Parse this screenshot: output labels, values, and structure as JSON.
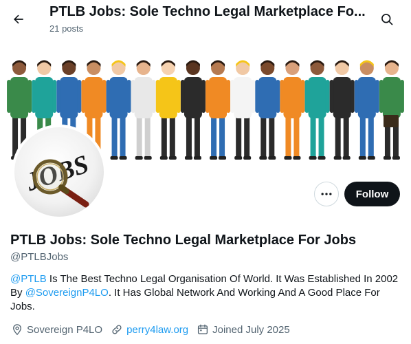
{
  "header": {
    "title": "PTLB Jobs: Sole Techno Legal Marketplace Fo...",
    "posts_count": "21 posts"
  },
  "banner": {
    "icon": "workers-illustration",
    "colors": {
      "blue": "#2f6db3",
      "orange": "#f08a24",
      "green": "#3a8a4a",
      "teal": "#1fa39a",
      "yellow": "#f5c518",
      "dark": "#2b2b2b"
    }
  },
  "avatar": {
    "logo_text": "JOBS",
    "icon": "magnifying-glass"
  },
  "actions": {
    "more_icon": "more-dots-icon",
    "follow_label": "Follow"
  },
  "profile": {
    "name": "PTLB Jobs: Sole Techno Legal Marketplace For Jobs",
    "handle": "@PTLBJobs",
    "bio": {
      "mention1": "@PTLB",
      "text1": " Is The Best Techno Legal Organisation Of World. It Was Established In 2002 By ",
      "mention2": "@SovereignP4LO",
      "text2": ". It Has Global Network And Working And A Good Place For Jobs."
    },
    "location": "Sovereign P4LO",
    "website": "perry4law.org",
    "joined": "Joined July 2025"
  },
  "theme": {
    "accent": "#1d9bf0",
    "text": "#0f1419",
    "muted": "#536471",
    "follow_bg": "#0f1419"
  }
}
